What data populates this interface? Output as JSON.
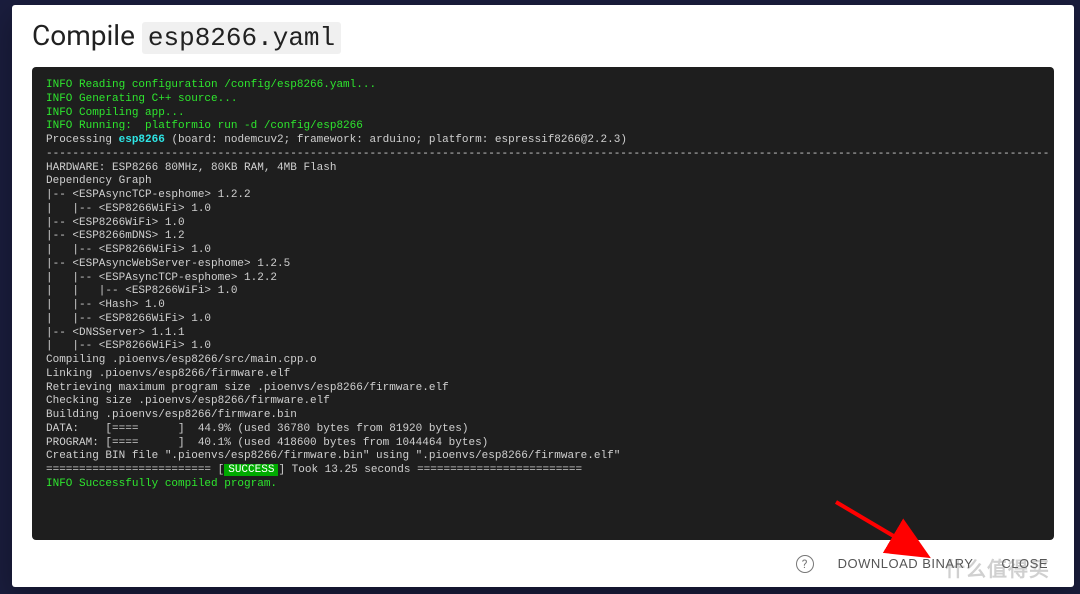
{
  "header": {
    "title_prefix": "Compile ",
    "filename": "esp8266.yaml"
  },
  "terminal": {
    "line1_info": "INFO Reading configuration /config/esp8266.yaml...",
    "line2_info": "INFO Generating C++ source...",
    "line3_info": "INFO Compiling app...",
    "line4_info": "INFO Running:  platformio run -d /config/esp8266",
    "proc_prefix": "Processing ",
    "proc_name": "esp8266",
    "proc_suffix": " (board: nodemcuv2; framework: arduino; platform: espressif8266@2.2.3)",
    "sep1": "--------------------------------------------------------------------------------------------------------------------------------------------------------",
    "hw": "HARDWARE: ESP8266 80MHz, 80KB RAM, 4MB Flash",
    "dep": "Dependency Graph",
    "d1": "|-- <ESPAsyncTCP-esphome> 1.2.2",
    "d2": "|   |-- <ESP8266WiFi> 1.0",
    "d3": "|-- <ESP8266WiFi> 1.0",
    "d4": "|-- <ESP8266mDNS> 1.2",
    "d5": "|   |-- <ESP8266WiFi> 1.0",
    "d6": "|-- <ESPAsyncWebServer-esphome> 1.2.5",
    "d7": "|   |-- <ESPAsyncTCP-esphome> 1.2.2",
    "d8": "|   |   |-- <ESP8266WiFi> 1.0",
    "d9": "|   |-- <Hash> 1.0",
    "d10": "|   |-- <ESP8266WiFi> 1.0",
    "d11": "|-- <DNSServer> 1.1.1",
    "d12": "|   |-- <ESP8266WiFi> 1.0",
    "c1": "Compiling .pioenvs/esp8266/src/main.cpp.o",
    "c2": "Linking .pioenvs/esp8266/firmware.elf",
    "c3": "Retrieving maximum program size .pioenvs/esp8266/firmware.elf",
    "c4": "Checking size .pioenvs/esp8266/firmware.elf",
    "c5": "Building .pioenvs/esp8266/firmware.bin",
    "data": "DATA:    [====      ]  44.9% (used 36780 bytes from 81920 bytes)",
    "prog": "PROGRAM: [====      ]  40.1% (used 418600 bytes from 1044464 bytes)",
    "create": "Creating BIN file \".pioenvs/esp8266/firmware.bin\" using \".pioenvs/esp8266/firmware.elf\"",
    "eq_left": "========================= [",
    "success": "SUCCESS",
    "eq_right": "] Took 13.25 seconds =========================",
    "final_info": "INFO Successfully compiled program."
  },
  "footer": {
    "help_glyph": "?",
    "download": "DOWNLOAD BINARY",
    "close": "CLOSE"
  },
  "watermark": "什么值得买"
}
